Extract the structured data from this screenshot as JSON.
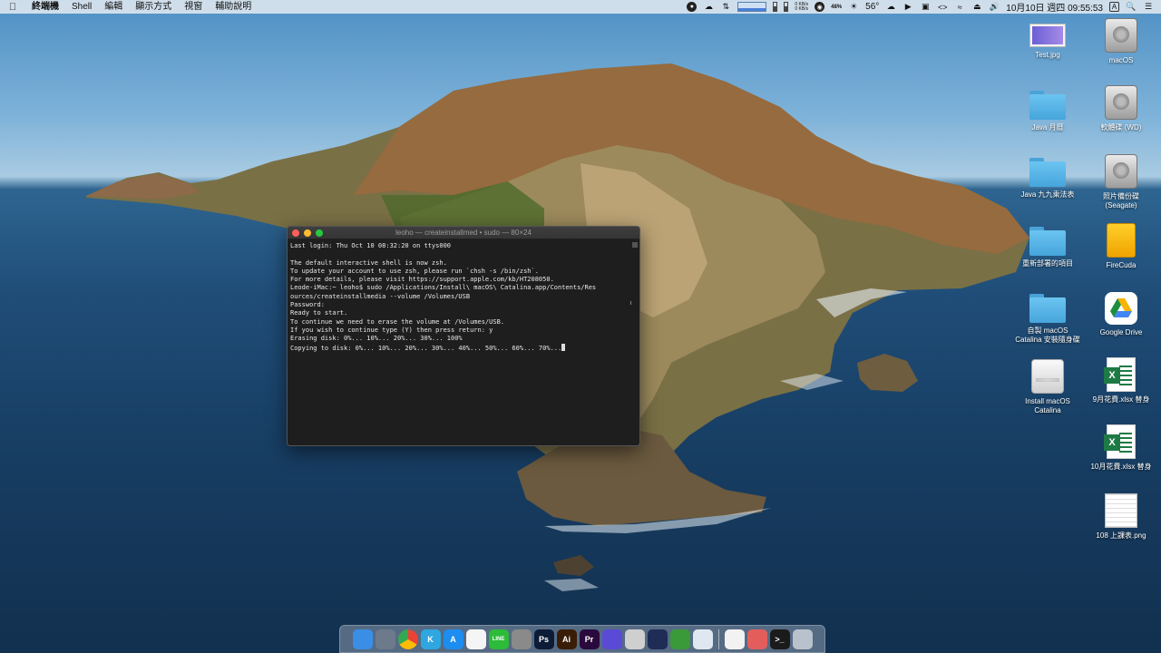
{
  "menubar": {
    "app_name": "終端機",
    "menus": [
      "Shell",
      "編輯",
      "顯示方式",
      "視窗",
      "輔助說明"
    ],
    "net_up": "0 KB/s",
    "net_down": "0 KB/s",
    "cpu_percent": "48%",
    "temperature": "56°",
    "clock": "10月10日 週四 09:55:53",
    "input_method": "A"
  },
  "terminal": {
    "title": "leoho — createinstallmed • sudo — 80×24",
    "lines": [
      "Last login: Thu Oct 10 08:32:20 on ttys000",
      "",
      "The default interactive shell is now zsh.",
      "To update your account to use zsh, please run `chsh -s /bin/zsh`.",
      "For more details, please visit https://support.apple.com/kb/HT208050.",
      "Leode-iMac:~ leoho$ sudo /Applications/Install\\ macOS\\ Catalina.app/Contents/Res",
      "ources/createinstallmedia --volume /Volumes/USB",
      "Password:",
      "Ready to start.",
      "To continue we need to erase the volume at /Volumes/USB.",
      "If you wish to continue type (Y) then press return: y",
      "Erasing disk: 0%... 10%... 20%... 30%... 100%",
      "Copying to disk: 0%... 10%... 20%... 30%... 40%... 50%... 60%... 70%..."
    ]
  },
  "desktop": {
    "icons_col1": [
      {
        "label": "Test.jpg",
        "kind": "jpg"
      },
      {
        "label": "Java 月曆",
        "kind": "folder"
      },
      {
        "label": "Java 九九乘法表",
        "kind": "folder"
      },
      {
        "label": "重新部署的項目",
        "kind": "folder"
      },
      {
        "label": "自製 macOS Catalina 安裝隨身碟",
        "kind": "folder"
      },
      {
        "label": "Install macOS Catalina",
        "kind": "disk-white"
      }
    ],
    "icons_col2": [
      {
        "label": "macOS",
        "kind": "disk"
      },
      {
        "label": "軟體碟 (WD)",
        "kind": "disk"
      },
      {
        "label": "照片備份碟 (Seagate)",
        "kind": "disk"
      },
      {
        "label": "FireCuda",
        "kind": "firecuda"
      },
      {
        "label": "Google Drive",
        "kind": "gdrive"
      },
      {
        "label": "9月花費.xlsx 替身",
        "kind": "xlsx"
      },
      {
        "label": "10月花費.xlsx 替身",
        "kind": "xlsx"
      },
      {
        "label": "108 上課表.png",
        "kind": "png"
      }
    ]
  },
  "dock": {
    "apps": [
      {
        "name": "finder",
        "label": "",
        "color": "#3a8ee6"
      },
      {
        "name": "launchpad",
        "label": "",
        "color": "#6d7a8c"
      },
      {
        "name": "chrome",
        "label": "",
        "color": "#ffffff"
      },
      {
        "name": "kakaotalk",
        "label": "K",
        "color": "#2fa6e0"
      },
      {
        "name": "app-store",
        "label": "A",
        "color": "#1d8df0"
      },
      {
        "name": "photos",
        "label": "",
        "color": "#f5f5f5"
      },
      {
        "name": "line",
        "label": "LINE",
        "color": "#2dbb3a"
      },
      {
        "name": "system-preferences",
        "label": "",
        "color": "#8a8a8a"
      },
      {
        "name": "photoshop",
        "label": "Ps",
        "color": "#0c1c36"
      },
      {
        "name": "illustrator",
        "label": "Ai",
        "color": "#3a1d06"
      },
      {
        "name": "premiere",
        "label": "Pr",
        "color": "#2a0a3c"
      },
      {
        "name": "imovie",
        "label": "",
        "color": "#5b4ad6"
      },
      {
        "name": "davinci",
        "label": "",
        "color": "#cfcfcf"
      },
      {
        "name": "activity-monitor",
        "label": "",
        "color": "#1f2c56"
      },
      {
        "name": "sourcetree",
        "label": "",
        "color": "#3a9a3a"
      },
      {
        "name": "browser",
        "label": "",
        "color": "#dfe8f0"
      },
      {
        "name": "preview",
        "label": "",
        "color": "#f2f2f2"
      },
      {
        "name": "script-editor",
        "label": "",
        "color": "#e45d5d"
      },
      {
        "name": "terminal",
        "label": ">_",
        "color": "#1b1b1b"
      },
      {
        "name": "trash",
        "label": "",
        "color": "#b8c2cc"
      }
    ]
  }
}
